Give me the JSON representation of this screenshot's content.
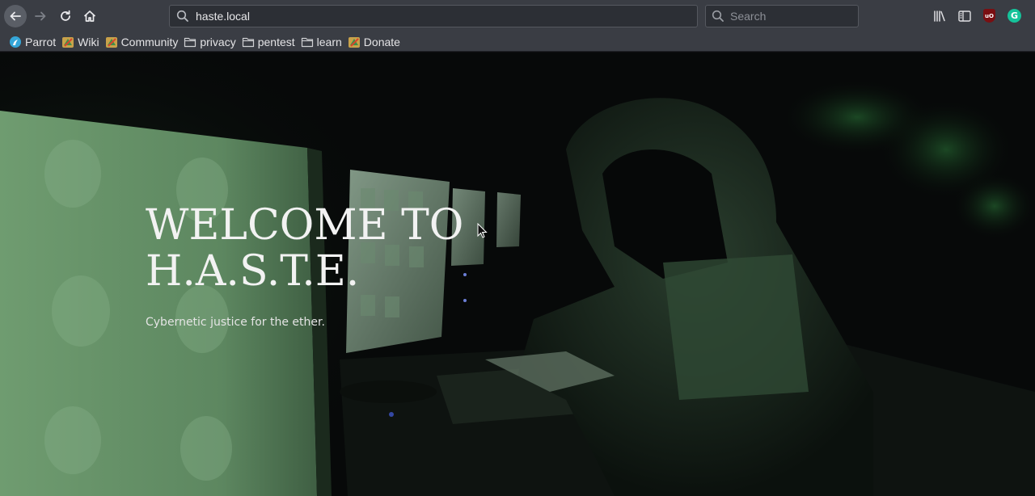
{
  "browser": {
    "url": "haste.local",
    "search_placeholder": "Search",
    "nav_icons": [
      "back-arrow-icon",
      "forward-arrow-icon",
      "reload-icon",
      "home-icon"
    ],
    "toolbar_icons": [
      "library-icon",
      "sidebar-icon",
      "ublock-icon",
      "grammarly-icon"
    ],
    "extension_badges": {
      "ublock": "uO",
      "grammarly": "G"
    }
  },
  "bookmarks": [
    {
      "label": "Parrot",
      "icon": "parrot-logo-icon"
    },
    {
      "label": "Wiki",
      "icon": "parrot-favicon-icon"
    },
    {
      "label": "Community",
      "icon": "parrot-favicon-icon"
    },
    {
      "label": "privacy",
      "icon": "folder-icon"
    },
    {
      "label": "pentest",
      "icon": "folder-icon"
    },
    {
      "label": "learn",
      "icon": "folder-icon"
    },
    {
      "label": "Donate",
      "icon": "parrot-favicon-icon"
    }
  ],
  "hero": {
    "title_line1": "WELCOME TO",
    "title_line2": "H.A.S.T.E.",
    "subtitle": "Cybernetic justice for the ether."
  },
  "colors": {
    "toolbar": "#3a3d44",
    "urlbar": "#2c2f35",
    "hero_green": "#6f9e72"
  }
}
